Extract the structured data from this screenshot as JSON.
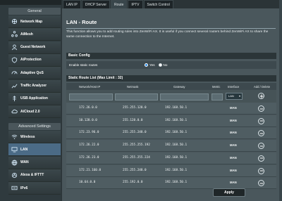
{
  "sidebar": {
    "general_label": "General",
    "advanced_label": "Advanced Settings",
    "general_items": [
      {
        "label": "Network Map",
        "icon": "network-map-icon"
      },
      {
        "label": "AiMesh",
        "icon": "aimesh-icon"
      },
      {
        "label": "Guest Network",
        "icon": "guest-network-icon"
      },
      {
        "label": "AiProtection",
        "icon": "shield-icon"
      },
      {
        "label": "Adaptive QoS",
        "icon": "qos-icon"
      },
      {
        "label": "Traffic Analyzer",
        "icon": "traffic-analyzer-icon"
      },
      {
        "label": "USB Application",
        "icon": "usb-icon"
      },
      {
        "label": "AiCloud 2.0",
        "icon": "cloud-icon"
      }
    ],
    "advanced_items": [
      {
        "label": "Wireless",
        "icon": "wireless-icon"
      },
      {
        "label": "LAN",
        "icon": "lan-icon",
        "active": true
      },
      {
        "label": "WAN",
        "icon": "wan-icon"
      },
      {
        "label": "Alexa & IFTTT",
        "icon": "alexa-icon"
      },
      {
        "label": "IPv6",
        "icon": "ipv6-icon"
      }
    ]
  },
  "tabs": [
    {
      "label": "LAN IP"
    },
    {
      "label": "DHCP Server"
    },
    {
      "label": "Route",
      "active": true
    },
    {
      "label": "IPTV"
    },
    {
      "label": "Switch Control"
    }
  ],
  "page": {
    "title": "LAN - Route",
    "description": "This function allows you to add routing rules into ZenWiFi AX. It is useful if you connect several routers behind ZenWiFi AX to share the same connection to the Internet."
  },
  "basic_config": {
    "heading": "Basic Config",
    "enable_label": "Enable static routes",
    "yes_label": "Yes",
    "no_label": "No",
    "selected": "Yes"
  },
  "route_table": {
    "heading": "Static Route List (Max Limit : 32)",
    "columns": [
      "Network/Host IP",
      "Netmask",
      "Gateway",
      "Metric",
      "Interface",
      "Add / Delete"
    ],
    "new_interface": "LAN",
    "rows": [
      {
        "ip": "172.26.0.0",
        "netmask": "255.255.128.0",
        "gateway": "192.168.50.1",
        "interface": "MAN"
      },
      {
        "ip": "10.128.0.0",
        "netmask": "255.128.0.0",
        "gateway": "192.168.50.1",
        "interface": "MAN"
      },
      {
        "ip": "172.23.96.0",
        "netmask": "255.255.248.0",
        "gateway": "192.168.50.1",
        "interface": "MAN"
      },
      {
        "ip": "172.26.22.0",
        "netmask": "255.255.255.192",
        "gateway": "192.168.50.1",
        "interface": "MAN"
      },
      {
        "ip": "172.26.23.0",
        "netmask": "255.255.255.224",
        "gateway": "192.168.50.1",
        "interface": "MAN"
      },
      {
        "ip": "172.21.160.0",
        "netmask": "255.255.248.0",
        "gateway": "192.168.50.1",
        "interface": "MAN"
      },
      {
        "ip": "10.64.0.0",
        "netmask": "255.192.0.0",
        "gateway": "192.168.50.1",
        "interface": "MAN"
      }
    ]
  },
  "apply_label": "Apply",
  "colors": {
    "accent": "#4b6b86",
    "panel": "#4a575c",
    "band": "#2b3538"
  }
}
